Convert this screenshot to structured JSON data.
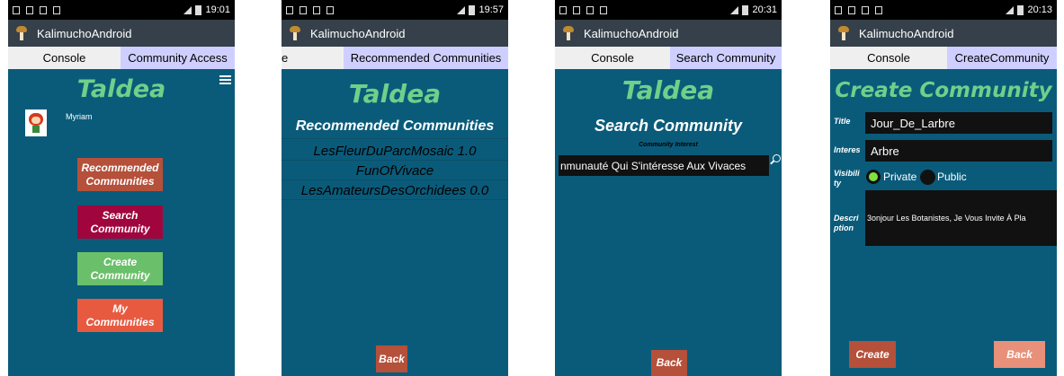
{
  "app_title": "KalimuchoAndroid",
  "screens": [
    {
      "status_time": "19:01",
      "tabs": [
        "Console",
        "Community Access"
      ],
      "logo": "Taldea",
      "user_name": "Myriam",
      "buttons": [
        "Recommended Communities",
        "Search Community",
        "Create Community",
        "My Communities"
      ]
    },
    {
      "status_time": "19:57",
      "tabs": [
        "e",
        "Recommended Communities"
      ],
      "logo": "Taldea",
      "heading": "Recommended Communities",
      "items": [
        "LesFleurDuParcMosaic  1.0",
        "FunOfVivace",
        "LesAmateursDesOrchidees  0.0"
      ],
      "back": "Back"
    },
    {
      "status_time": "20:31",
      "tabs": [
        "Console",
        "Search Community"
      ],
      "logo": "Taldea",
      "heading": "Search Community",
      "interest_label": "Community Interest",
      "search_value": "nmunauté Qui S'intéresse Aux Vivaces",
      "back": "Back"
    },
    {
      "status_time": "20:13",
      "tabs": [
        "Console",
        "CreateCommunity"
      ],
      "heading": "Create Community",
      "title_label": "Title",
      "title_value": "Jour_De_Larbre",
      "interest_label": "Interes",
      "interest_value": "Arbre",
      "visibility_label": "Visibili ty",
      "private_label": "Private",
      "public_label": "Public",
      "description_label": "Descri ption",
      "description_value": "3onjour Les Botanistes,  Je Vous Invite À Pla",
      "create": "Create",
      "back": "Back"
    }
  ],
  "colors": {
    "background": "#0a5b7a",
    "logo": "#6fd08a",
    "recommended": "#b5503a",
    "search": "#a0063d",
    "create": "#6ac06a",
    "my": "#e85a40"
  }
}
